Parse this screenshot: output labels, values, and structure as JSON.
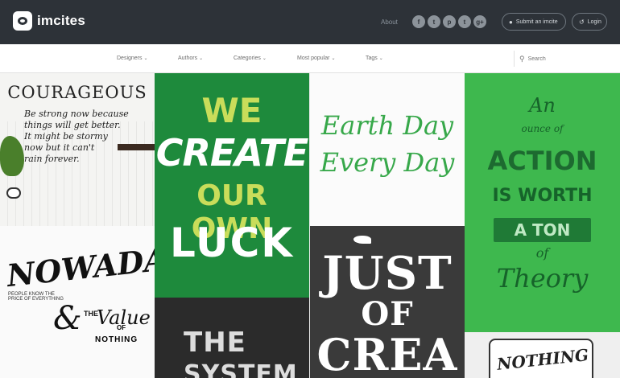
{
  "header": {
    "logo_text": "imcites",
    "about": "About",
    "social": [
      {
        "icon": "facebook-icon",
        "glyph": "f"
      },
      {
        "icon": "twitter-icon",
        "glyph": "t"
      },
      {
        "icon": "pinterest-icon",
        "glyph": "p"
      },
      {
        "icon": "tumblr-icon",
        "glyph": "t"
      },
      {
        "icon": "google-plus-icon",
        "glyph": "g+"
      }
    ],
    "submit_label": "Submit an imcite",
    "login_label": "Login"
  },
  "nav": {
    "items": [
      "Designers",
      "Authors",
      "Categories",
      "Most popular",
      "Tags"
    ],
    "search_placeholder": "Search"
  },
  "tiles": {
    "courageous": {
      "title": "COURAGEOUS",
      "quote": [
        "Be strong now because",
        "things will get better.",
        "It might be stormy",
        "now but it can't",
        "rain forever."
      ]
    },
    "nowadays": {
      "title": "NOWADAYS",
      "small": "PEOPLE KNOW THE PRICE OF EVERYTHING",
      "amp": "&",
      "the": "THE",
      "value": "Value",
      "of": "OF",
      "nothing": "NOTHING"
    },
    "luck": {
      "we": "WE",
      "create": "CREATE",
      "our_own": "OUR OWN",
      "luck": "LUCK"
    },
    "system": {
      "the": "THE",
      "system": "SYSTEM"
    },
    "earthday": {
      "line1": "Earth Day",
      "line2": "Every Day"
    },
    "creativity": {
      "just": "JUST",
      "of": "OF",
      "crea": "CREA"
    },
    "action": {
      "an": "An",
      "ounce_of": "ounce of",
      "action": "ACTION",
      "is_worth": "IS WORTH",
      "a_ton": "A TON",
      "of": "of",
      "theory": "Theory"
    },
    "mug": {
      "text": "NOTHING"
    }
  }
}
